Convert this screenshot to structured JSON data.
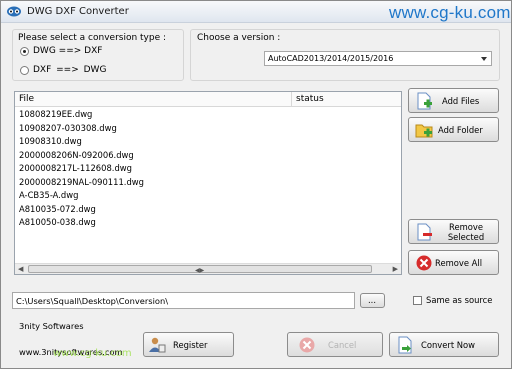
{
  "window": {
    "title": "DWG DXF Converter",
    "watermark": "www.cg-ku.com"
  },
  "conversion": {
    "label": "Please select a conversion type :",
    "options": [
      {
        "label": "DWG ==> DXF",
        "selected": true
      },
      {
        "label": "DXF ==> DWG",
        "selected": false
      }
    ]
  },
  "version": {
    "label": "Choose a version :",
    "selected": "AutoCAD2013/2014/2015/2016"
  },
  "file_list": {
    "columns": [
      "File",
      "status"
    ],
    "files": [
      "10808219EE.dwg",
      "10908207-030308.dwg",
      "10908310.dwg",
      "2000008206N-092006.dwg",
      "2000008217L-112608.dwg",
      "2000008219NAL-090111.dwg",
      "A-CB35-A.dwg",
      "A810035-072.dwg",
      "A810050-038.dwg"
    ]
  },
  "buttons": {
    "add_files": "Add Files",
    "add_folder": "Add Folder",
    "remove_selected": "Remove Selected",
    "remove_all": "Remove All",
    "browse": "...",
    "register": "Register",
    "cancel": "Cancel",
    "convert_now": "Convert Now"
  },
  "output": {
    "path": "C:\\Users\\Squall\\Desktop\\Conversion\\",
    "same_as_source_label": "Same as source",
    "same_as_source_checked": false
  },
  "footer": {
    "company": "3nity Softwares",
    "website": "www.3nitysoftwares.com",
    "watermark": "www.cg-ku.com"
  },
  "colors": {
    "watermark_blue": "#1f77c9",
    "add_icon_green": "#3aa13a",
    "remove_all_red": "#d62b2b"
  }
}
